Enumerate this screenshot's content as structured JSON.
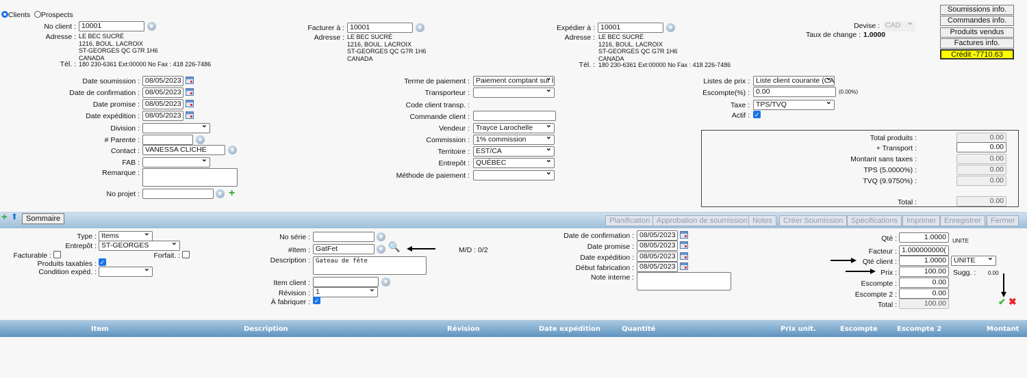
{
  "client_type": {
    "options": [
      "Clients",
      "Prospects"
    ],
    "selected": "Clients"
  },
  "client": {
    "label": "No client :",
    "value": "10001",
    "address_label": "Adresse :",
    "address": [
      "LE BEC SUCRÉ",
      "1216, BOUL. LACROIX",
      "ST-GEORGES QC G7R 1H6",
      "CANADA"
    ],
    "tel_label": "Tél. :",
    "tel": "180 230-6361 Ext:00000 No Fax : 418 226-7486"
  },
  "billing": {
    "label": "Facturer à :",
    "value": "10001",
    "address_label": "Adresse :",
    "address": [
      "LE BEC SUCRÉ",
      "1216, BOUL. LACROIX",
      "ST-GEORGES QC G7R 1H6",
      "CANADA"
    ]
  },
  "shipping": {
    "label": "Expédier à :",
    "value": "10001",
    "address_label": "Adresse :",
    "address": [
      "LE BEC SUCRÉ",
      "1216, BOUL. LACROIX",
      "ST-GEORGES QC G7R 1H6",
      "CANADA"
    ],
    "tel_label": "Tél. :",
    "tel": "180 230-6361 Ext:00000 No Fax : 418 226-7486"
  },
  "currency": {
    "label": "Devise :",
    "value": "CAD",
    "rate_label": "Taux de change :",
    "rate": "1.0000"
  },
  "side_buttons": [
    "Soumissions info.",
    "Commandes info.",
    "Produits vendus",
    "Factures info."
  ],
  "credit": {
    "label": "Crédit -7710.63",
    "color": "#ffff00"
  },
  "left_form": {
    "date_soumission": {
      "label": "Date soumission :",
      "value": "08/05/2023"
    },
    "date_confirmation": {
      "label": "Date de confirmation :",
      "value": "08/05/2023"
    },
    "date_promise": {
      "label": "Date promise :",
      "value": "08/05/2023"
    },
    "date_expedition": {
      "label": "Date expédition :",
      "value": "08/05/2023"
    },
    "division": {
      "label": "Division :",
      "value": ""
    },
    "parente": {
      "label": "# Parente :",
      "value": ""
    },
    "contact": {
      "label": "Contact :",
      "value": "VANESSA CLICHE"
    },
    "fab": {
      "label": "FAB :",
      "value": ""
    },
    "remarque": {
      "label": "Remarque :",
      "value": ""
    },
    "projet": {
      "label": "No projet :",
      "value": ""
    }
  },
  "mid_form": {
    "terme": {
      "label": "Terme de paiement :",
      "value": "Paiement comptant sur l"
    },
    "transporteur": {
      "label": "Transporteur :",
      "value": ""
    },
    "code_transp": {
      "label": "Code client transp. :"
    },
    "commande": {
      "label": "Commande client :",
      "value": ""
    },
    "vendeur": {
      "label": "Vendeur :",
      "value": "Trayce Larochelle"
    },
    "commission": {
      "label": "Commission :",
      "value": "1% commission"
    },
    "territoire": {
      "label": "Territoire :",
      "value": "EST/CA"
    },
    "entrepot": {
      "label": "Entrepôt :",
      "value": "QUÉBEC"
    },
    "methode": {
      "label": "Méthode de paiement :",
      "value": ""
    }
  },
  "right_form": {
    "listes": {
      "label": "Listes de prix :",
      "value": "Liste client courante (CA"
    },
    "escompte": {
      "label": "Escompte(%) :",
      "value": "0.00",
      "note": "(0.00%)"
    },
    "taxe": {
      "label": "Taxe :",
      "value": "TPS/TVQ"
    },
    "actif": {
      "label": "Actif :",
      "checked": true
    }
  },
  "totals": [
    {
      "label": "Total produits :",
      "value": "0.00"
    },
    {
      "label": "+ Transport :",
      "value": "0.00"
    },
    {
      "label": "Montant sans taxes :",
      "value": "0.00"
    },
    {
      "label": "TPS (5.0000%) :",
      "value": "0.00"
    },
    {
      "label": "TVQ (9.9750%) :",
      "value": "0.00"
    },
    {
      "label": "Total :",
      "value": "0.00"
    }
  ],
  "toolbar": {
    "sommaire": "Sommaire",
    "tabs": [
      "Planification",
      "Approbation de soumission",
      "Notes",
      "Créer Soumission",
      "Spécifications",
      "Imprimer",
      "Enregistrer",
      "Fermer"
    ]
  },
  "line": {
    "type": {
      "label": "Type :",
      "value": "Items"
    },
    "entrepot": {
      "label": "Entrepôt :",
      "value": "ST-GEORGES"
    },
    "facturable": {
      "label": "Facturable :",
      "checked": false
    },
    "forfait": {
      "label": "Forfait. :",
      "checked": false
    },
    "taxables": {
      "label": "Produits taxables :",
      "checked": true
    },
    "condition": {
      "label": "Condition expéd. :",
      "value": ""
    },
    "no_serie": {
      "label": "No série :",
      "value": ""
    },
    "item": {
      "label": "#Item :",
      "value": "GatFet"
    },
    "md": "M/D : 0/2",
    "description": {
      "label": "Description :",
      "value": "Gateau de fête"
    },
    "item_client": {
      "label": "Item client :",
      "value": ""
    },
    "revision": {
      "label": "Révision :",
      "value": "1"
    },
    "a_fabriquer": {
      "label": "À fabriquer :",
      "checked": true
    },
    "date_confirmation": {
      "label": "Date de confirmation :",
      "value": "08/05/2023"
    },
    "date_promise": {
      "label": "Date promise :",
      "value": "08/05/2023"
    },
    "date_expedition": {
      "label": "Date expédition :",
      "value": "08/05/2023"
    },
    "debut_fab": {
      "label": "Début fabrication :",
      "value": "08/05/2023"
    },
    "note_interne": {
      "label": "Note interne :",
      "value": ""
    },
    "qte": {
      "label": "Qté :",
      "value": "1.0000",
      "unit": "UNITE"
    },
    "facteur": {
      "label": "Facteur :",
      "value": "1.000000000("
    },
    "qte_client": {
      "label": "Qté client :",
      "value": "1.0000",
      "unit": "UNITE"
    },
    "prix": {
      "label": "Prix :",
      "value": "100.00",
      "sugg_label": "Sugg. :",
      "sugg": "0.00"
    },
    "escompte": {
      "label": "Escompte :",
      "value": "0.00"
    },
    "escompte2": {
      "label": "Escompte 2 :",
      "value": "0.00"
    },
    "total": {
      "label": "Total :",
      "value": "100.00"
    }
  },
  "table_headers": [
    "Item",
    "Description",
    "Révision",
    "Date expédition",
    "Quantité",
    "Prix unit.",
    "Escompte",
    "Escompte 2",
    "Montant"
  ]
}
